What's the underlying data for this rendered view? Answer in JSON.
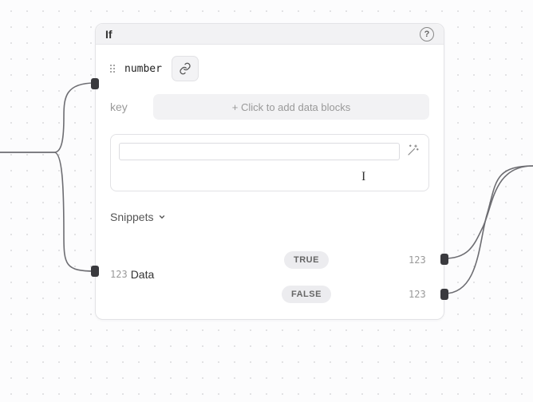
{
  "node": {
    "title": "If",
    "input_param": "number",
    "key_label": "key",
    "add_blocks_placeholder": "+ Click to add data blocks",
    "snippets_label": "Snippets",
    "data_output_label": "Data",
    "output_type_hint": "123",
    "branches": {
      "true": "TRUE",
      "false": "FALSE"
    },
    "branch_type_hint": "123"
  }
}
